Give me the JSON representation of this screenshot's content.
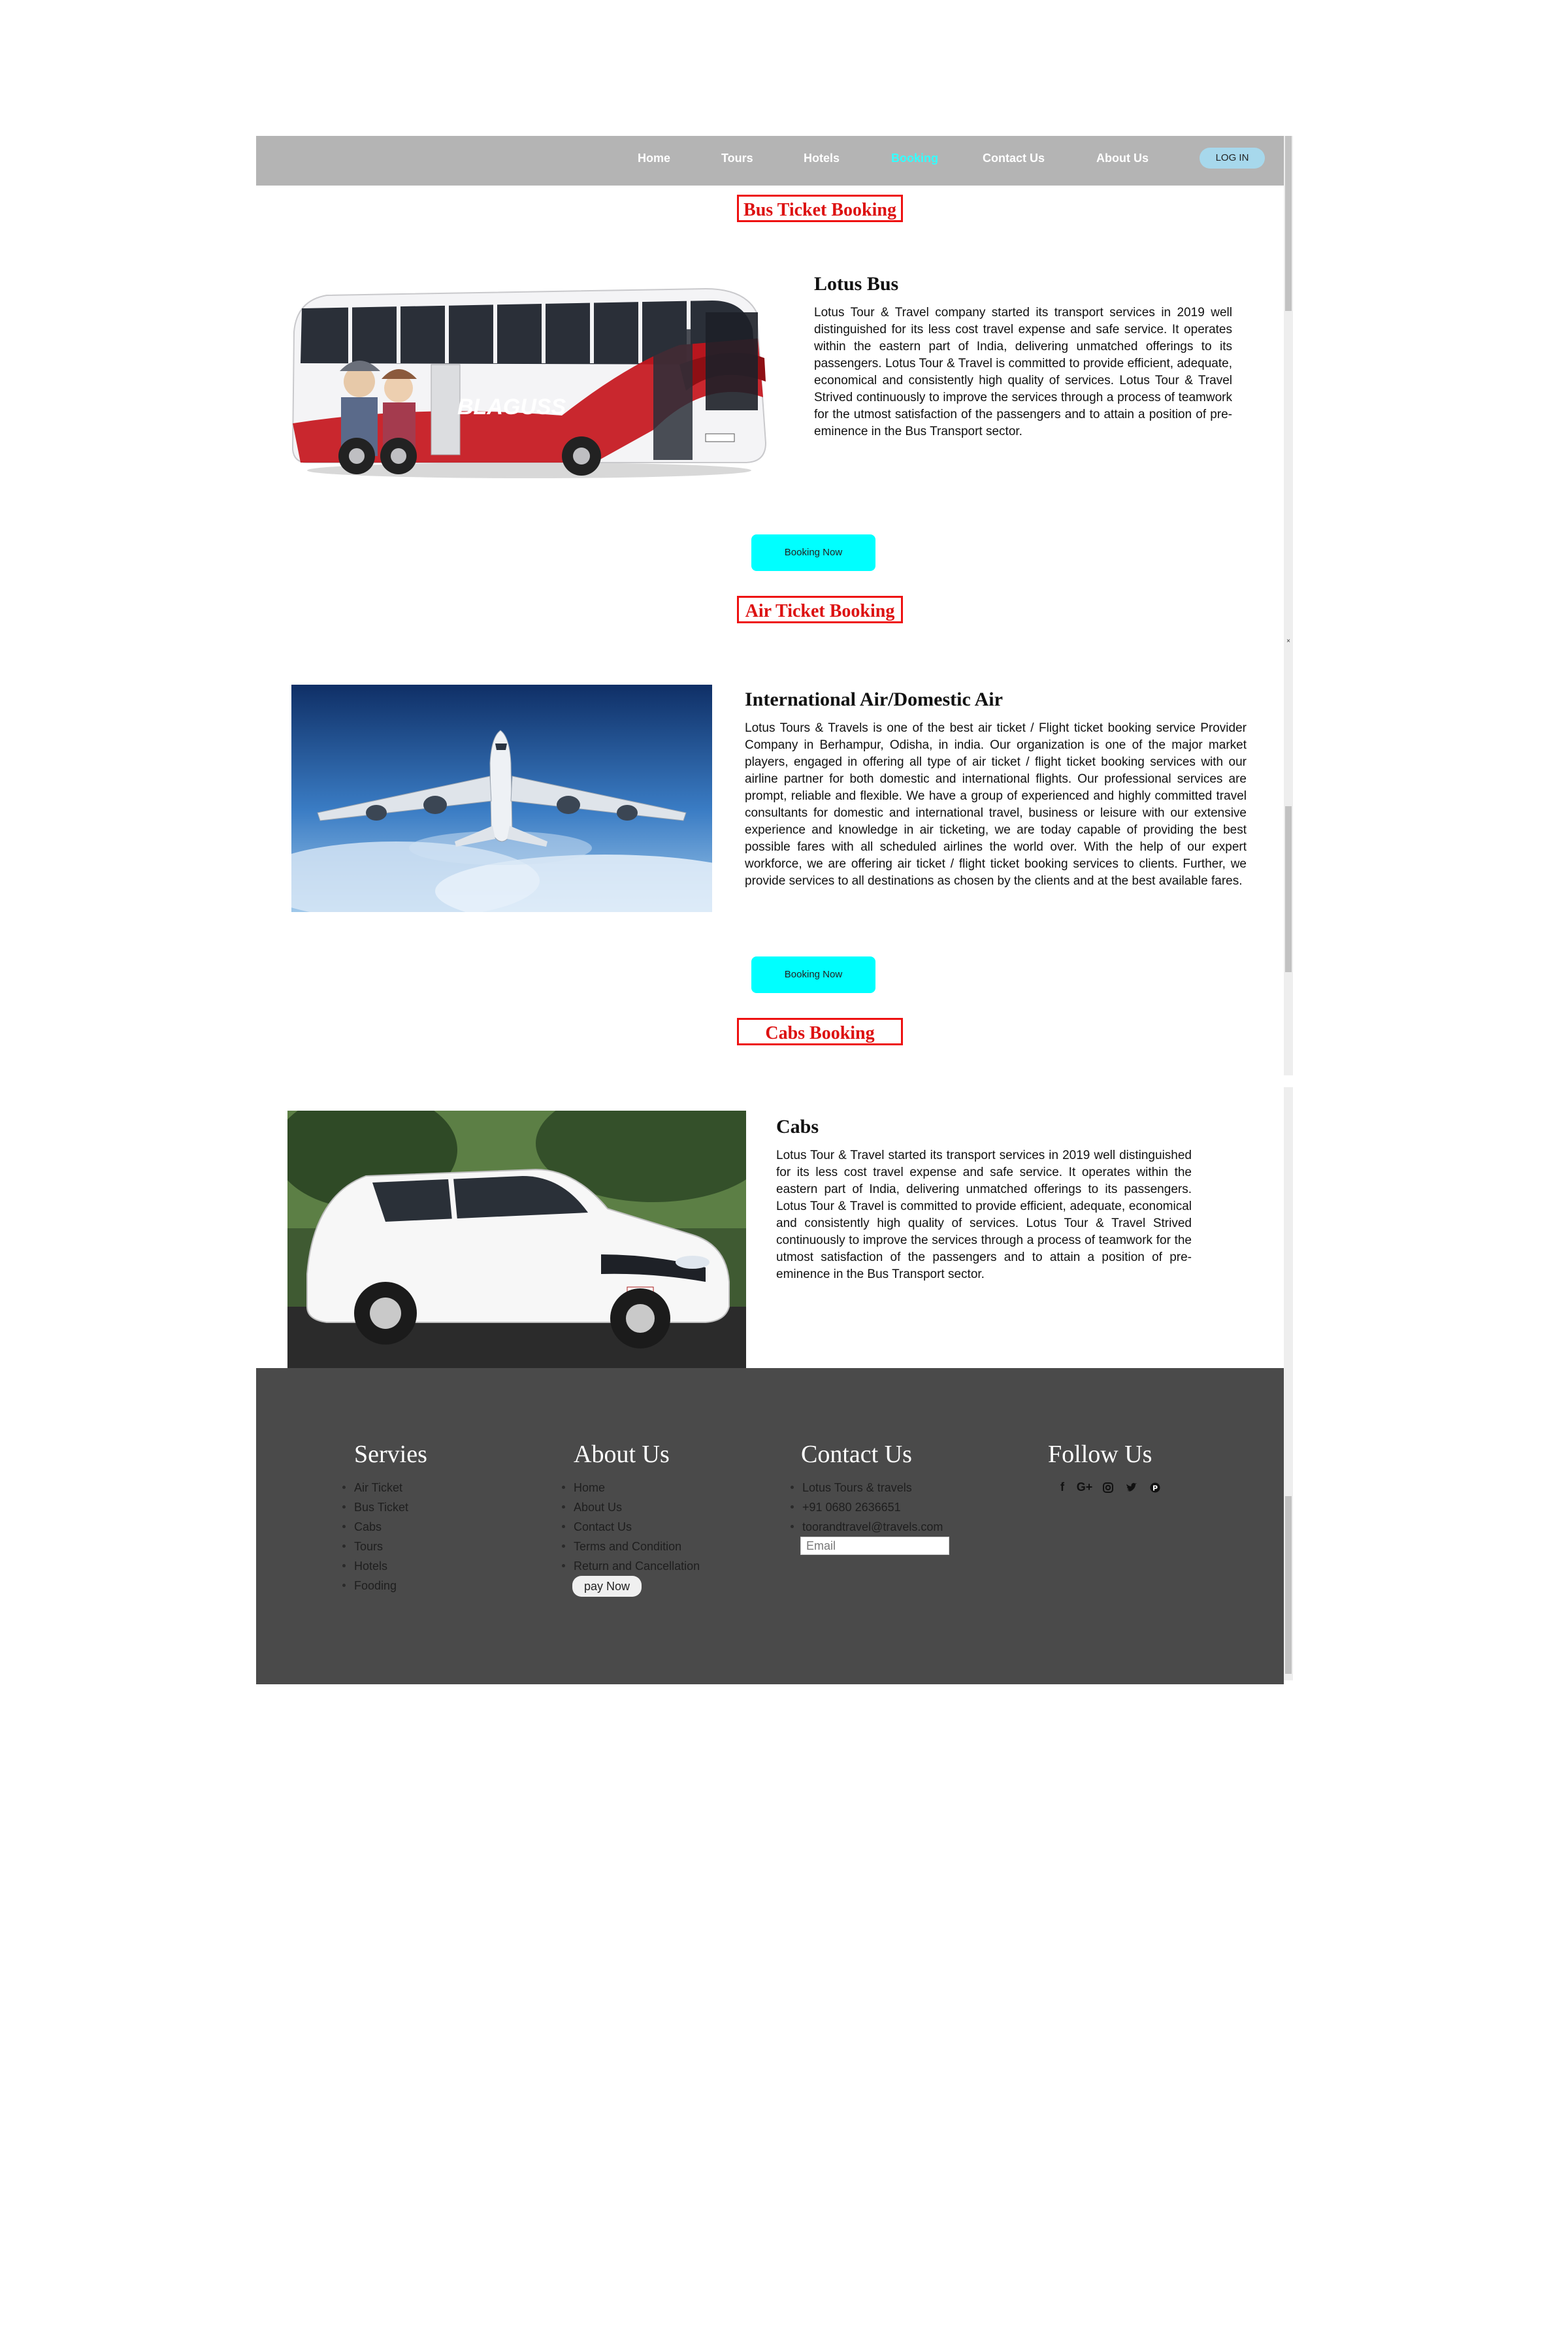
{
  "nav": {
    "items": [
      {
        "label": "Home"
      },
      {
        "label": "Tours"
      },
      {
        "label": "Hotels"
      },
      {
        "label": "Booking"
      },
      {
        "label": "Contact Us"
      },
      {
        "label": "About Us"
      }
    ],
    "login_label": "LOG IN",
    "active_color": "#33ffff"
  },
  "sections": {
    "bus": {
      "title": "Bus Ticket Booking",
      "heading": "Lotus Bus",
      "text": "Lotus Tour & Travel company started its transport services in 2019 well distinguished for its less cost travel expense and safe service. It operates within the eastern part of India, delivering unmatched offerings to its passengers. Lotus Tour & Travel is committed to provide efficient, adequate, economical and consistently high quality of services. Lotus Tour & Travel Strived continuously to improve the services through a process of teamwork for the utmost satisfaction of the passengers and to attain a position of pre-eminence in the Bus Transport sector.",
      "button": "Booking Now",
      "bus_brand": "BLAGUSS"
    },
    "air": {
      "title": "Air Ticket Booking",
      "heading": "International Air/Domestic Air",
      "text": "Lotus Tours & Travels is one of the best air ticket / Flight ticket booking service Provider Company in Berhampur, Odisha, in india. Our organization is one of the major market players, engaged in offering all type of air ticket / flight ticket booking services with our airline partner for both domestic and international flights. Our professional services are prompt, reliable and flexible. We have a group of experienced and highly committed travel consultants for domestic and international travel, business or leisure with our extensive experience and knowledge in air ticketing, we are today capable of providing the best possible fares with all scheduled airlines the world over. With the help of our expert workforce, we are offering air ticket / flight ticket booking services to clients. Further, we provide services to all destinations as chosen by the clients and at the best available fares.",
      "button": "Booking Now"
    },
    "cabs": {
      "title": "Cabs Booking",
      "heading": "Cabs",
      "text": "Lotus Tour & Travel started its transport services in 2019 well distinguished for its less cost travel expense and safe service. It operates within the eastern part of India, delivering unmatched offerings to its passengers. Lotus Tour & Travel is committed to provide efficient, adequate, economical and consistently high quality of services. Lotus Tour & Travel Strived continuously to improve the services through a process of teamwork for the utmost satisfaction of the passengers and to attain a position of pre-eminence in the Bus Transport sector."
    }
  },
  "footer": {
    "services": {
      "title": "Servies",
      "items": [
        "Air Ticket",
        "Bus Ticket",
        "Cabs",
        "Tours",
        "Hotels",
        "Fooding"
      ]
    },
    "about": {
      "title": "About Us",
      "items": [
        "Home",
        "About Us",
        "Contact Us",
        "Terms and Condition",
        "Return and Cancellation"
      ],
      "pay_label": "pay Now"
    },
    "contact": {
      "title": "Contact Us",
      "items": [
        "Lotus Tours & travels",
        "+91 0680 2636651",
        "toorandtravel@travels.com"
      ],
      "email_placeholder": "Email"
    },
    "follow": {
      "title": "Follow Us",
      "icons": [
        "facebook-icon",
        "google-plus-icon",
        "instagram-icon",
        "twitter-icon",
        "pinterest-icon"
      ]
    }
  }
}
